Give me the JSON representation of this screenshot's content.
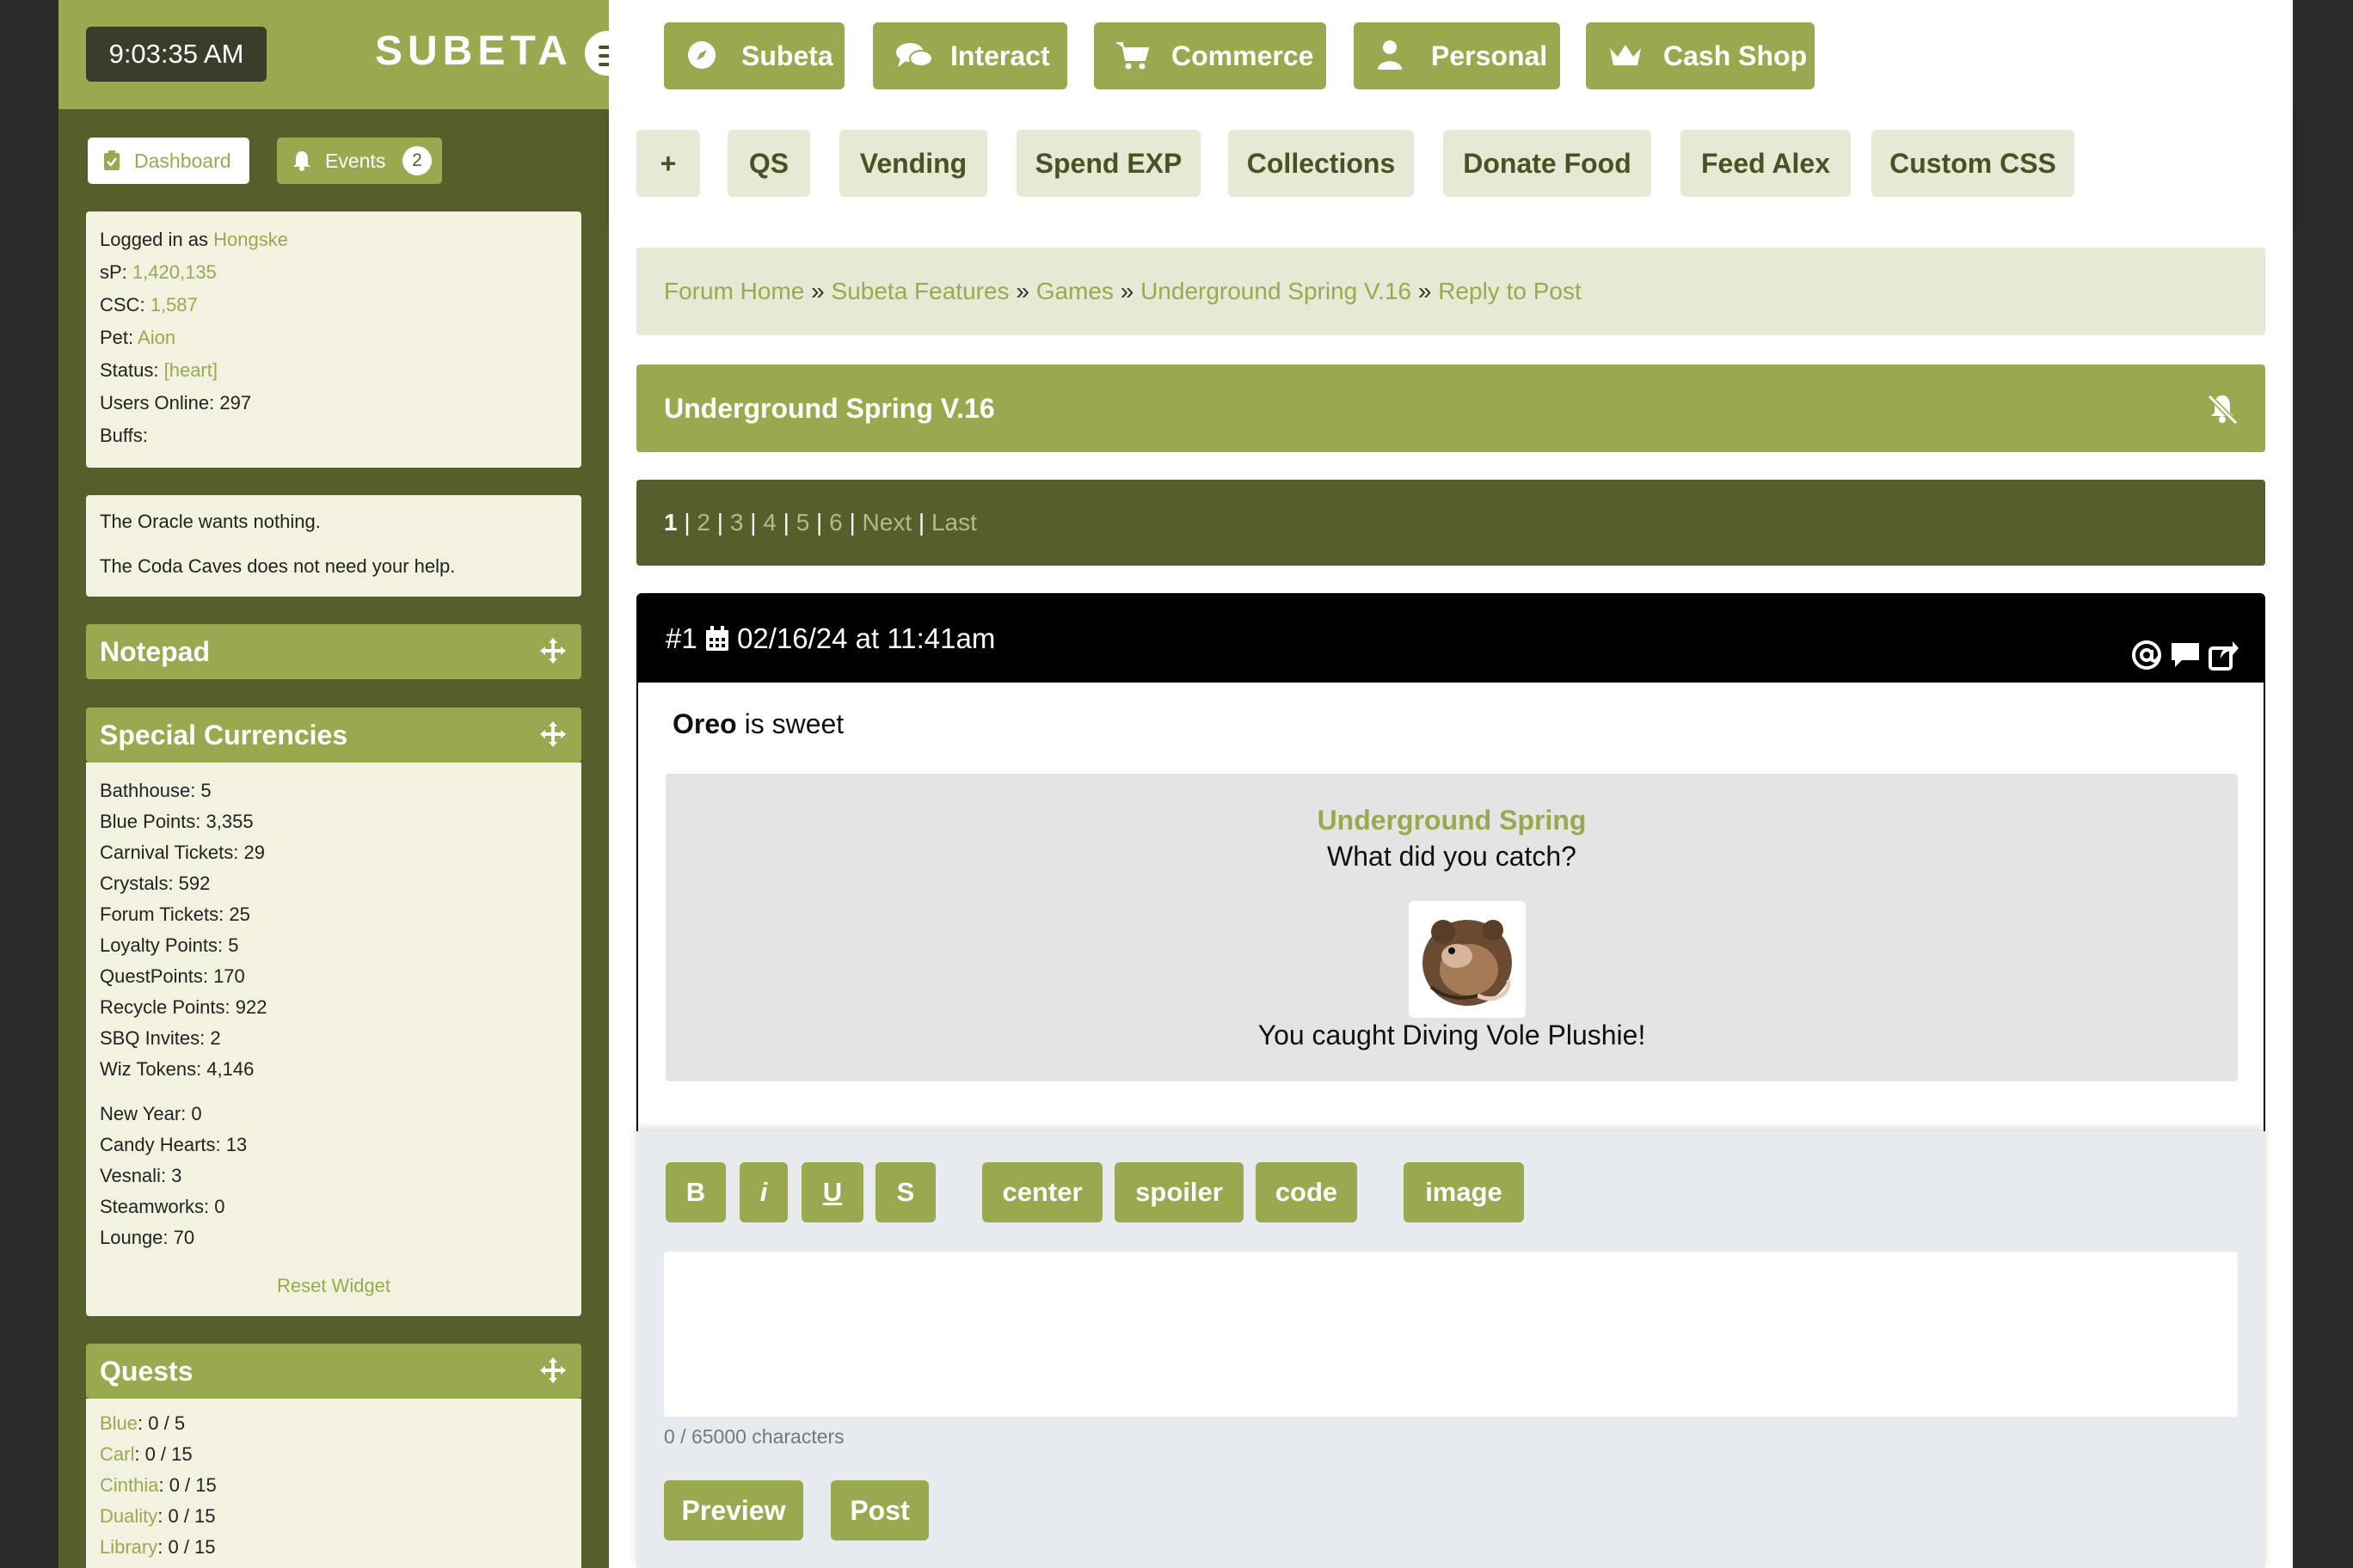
{
  "header": {
    "clock": "9:03:35 AM",
    "logo": "SUBETA",
    "nav": [
      {
        "label": "Subeta",
        "icon": "compass-icon"
      },
      {
        "label": "Interact",
        "icon": "comments-icon"
      },
      {
        "label": "Commerce",
        "icon": "cart-icon"
      },
      {
        "label": "Personal",
        "icon": "user-icon"
      },
      {
        "label": "Cash Shop",
        "icon": "crown-icon"
      }
    ],
    "subnav": [
      "+",
      "QS",
      "Vending",
      "Spend EXP",
      "Collections",
      "Donate Food",
      "Feed Alex",
      "Custom CSS"
    ]
  },
  "sidebar": {
    "dashboard_label": "Dashboard",
    "events_label": "Events",
    "events_count": "2",
    "user": {
      "logged_in_label": "Logged in as",
      "username": "Hongske",
      "sp_label": "sP:",
      "sp": "1,420,135",
      "csc_label": "CSC:",
      "csc": "1,587",
      "pet_label": "Pet:",
      "pet": "Aion",
      "status_label": "Status:",
      "status": "[heart]",
      "online_label": "Users Online:",
      "online": "297",
      "buffs_label": "Buffs:"
    },
    "messages": [
      "The Oracle wants nothing.",
      "The Coda Caves does not need your help."
    ],
    "notepad_title": "Notepad",
    "currencies_title": "Special Currencies",
    "currencies": [
      "Bathhouse: 5",
      "Blue Points: 3,355",
      "Carnival Tickets: 29",
      "Crystals: 592",
      "Forum Tickets: 25",
      "Loyalty Points: 5",
      "QuestPoints: 170",
      "Recycle Points: 922",
      "SBQ Invites: 2",
      "Wiz Tokens: 4,146"
    ],
    "seasonal": [
      "New Year: 0",
      "Candy Hearts: 13",
      "Vesnali: 3",
      "Steamworks: 0",
      "Lounge: 70"
    ],
    "reset_label": "Reset Widget",
    "quests_title": "Quests",
    "quests": [
      {
        "name": "Blue",
        "value": ": 0 / 5"
      },
      {
        "name": "Carl",
        "value": ": 0 / 15"
      },
      {
        "name": "Cinthia",
        "value": ": 0 / 15"
      },
      {
        "name": "Duality",
        "value": ": 0 / 15"
      },
      {
        "name": "Library",
        "value": ": 0 / 15"
      }
    ]
  },
  "breadcrumb": [
    "Forum Home",
    "Subeta Features",
    "Games",
    "Underground Spring V.16",
    "Reply to Post"
  ],
  "breadcrumb_sep": "»",
  "thread": {
    "title": "Underground Spring V.16",
    "pages": [
      "1",
      "2",
      "3",
      "4",
      "5",
      "6",
      "Next",
      "Last"
    ]
  },
  "post": {
    "number": "#1",
    "date": "02/16/24 at 11:41am",
    "author": "Oreo",
    "text": " is sweet",
    "game_title": "Underground Spring",
    "game_question": "What did you catch?",
    "game_result": "You caught Diving Vole Plushie!"
  },
  "editor": {
    "buttons": [
      "B",
      "i",
      "U",
      "S",
      "center",
      "spoiler",
      "code",
      "image"
    ],
    "char_count": "0 / 65000 characters",
    "preview_label": "Preview",
    "post_label": "Post"
  }
}
